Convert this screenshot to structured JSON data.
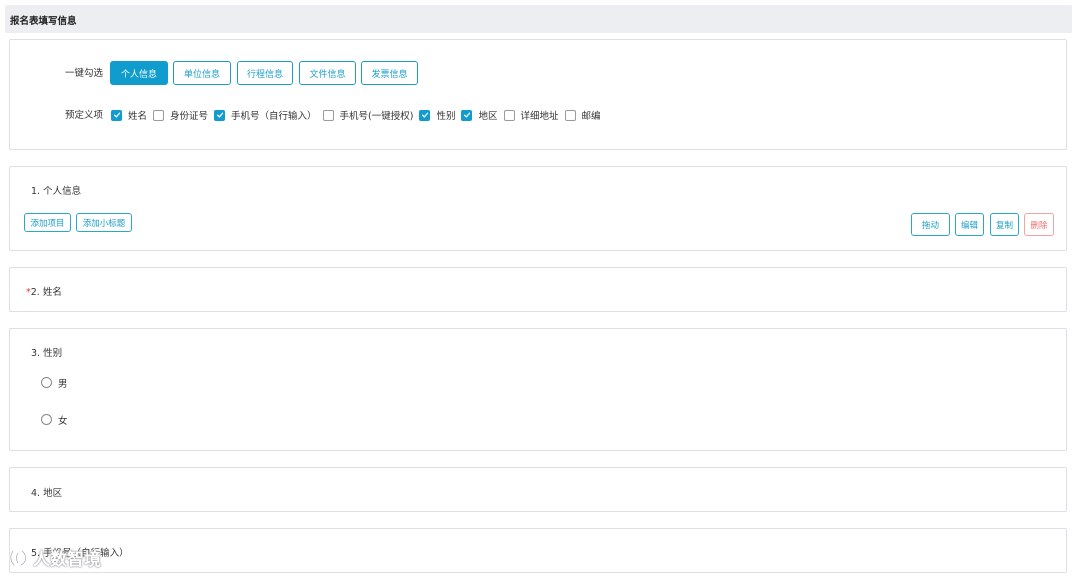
{
  "header": {
    "title": "报名表填写信息"
  },
  "quick_select": {
    "label": "一键勾选",
    "buttons": [
      "个人信息",
      "单位信息",
      "行程信息",
      "文件信息",
      "发票信息"
    ]
  },
  "predefined": {
    "label": "预定义项",
    "items": [
      {
        "label": "姓名",
        "checked": true
      },
      {
        "label": "身份证号",
        "checked": false
      },
      {
        "label": "手机号（自行输入）",
        "checked": true
      },
      {
        "label": "手机号(一键授权)",
        "checked": false
      },
      {
        "label": "性别",
        "checked": true
      },
      {
        "label": "地区",
        "checked": true
      },
      {
        "label": "详细地址",
        "checked": false
      },
      {
        "label": "邮编",
        "checked": false
      }
    ]
  },
  "section1": {
    "title": "1.  个人信息",
    "add_item": "添加项目",
    "add_subtitle": "添加小标题",
    "drag": "拖动",
    "edit": "编辑",
    "copy": "复制",
    "delete": "删除"
  },
  "section2": {
    "required_mark": "*",
    "title": "2.  姓名"
  },
  "section3": {
    "title": "3.  性别",
    "options": [
      "男",
      "女"
    ]
  },
  "section4": {
    "title": "4.  地区"
  },
  "section5": {
    "title": "5.  手机号（自行输入）"
  },
  "watermark": {
    "text": "人数智境"
  },
  "colors": {
    "accent": "#109ccc",
    "danger": "#ef6f6f",
    "border": "#dcdfe6",
    "header_bg": "#eceef1"
  }
}
